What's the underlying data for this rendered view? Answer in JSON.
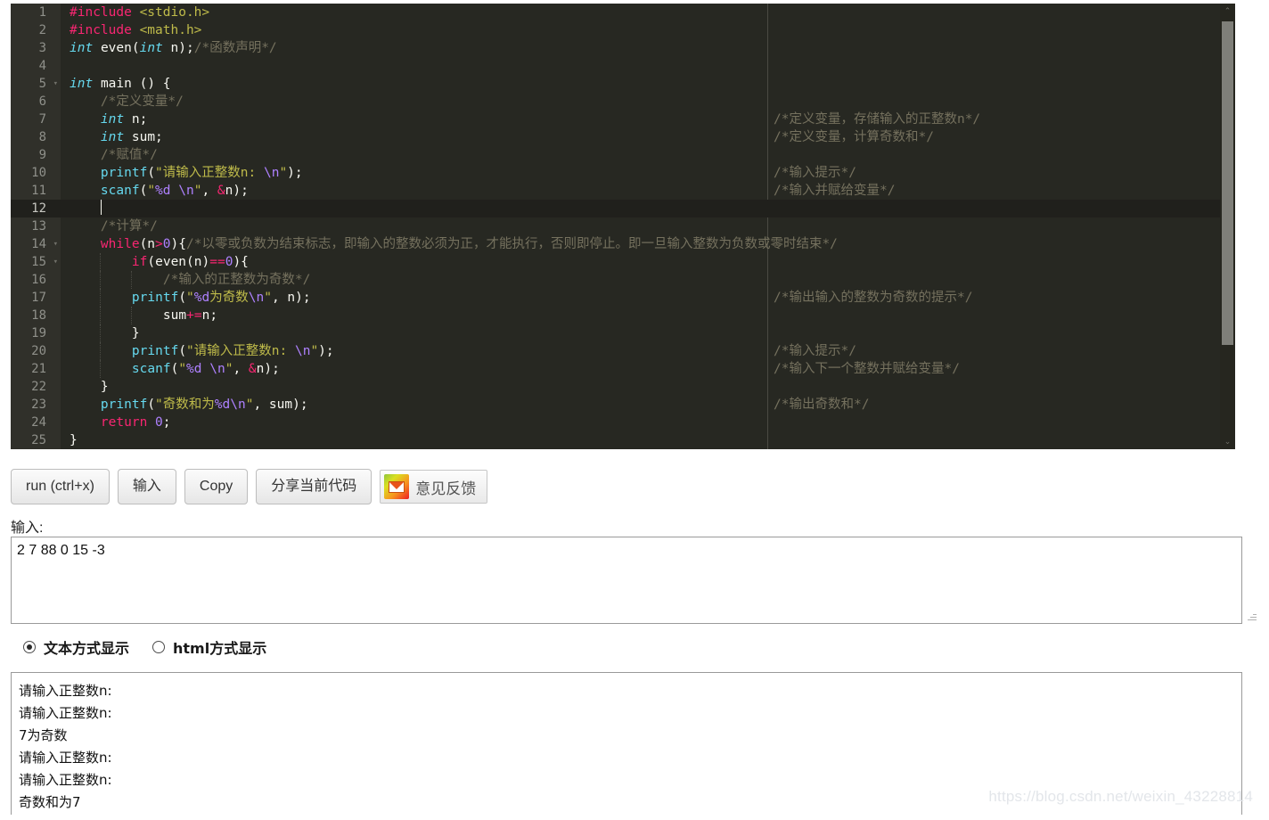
{
  "editor": {
    "active_line": 12,
    "theme_colors": {
      "background": "#272822",
      "gutter_background": "#30302a",
      "active_line": "#20201c",
      "comment": "#75715e",
      "keyword": "#66d9ef",
      "operator": "#f92672",
      "string": "#bfbb4a",
      "escape": "#ae81ff",
      "number": "#ae81ff",
      "foreground": "#f8f8f2"
    },
    "lines": [
      {
        "n": "1",
        "fold": false
      },
      {
        "n": "2",
        "fold": false
      },
      {
        "n": "3",
        "fold": false
      },
      {
        "n": "4",
        "fold": false
      },
      {
        "n": "5",
        "fold": true
      },
      {
        "n": "6",
        "fold": false
      },
      {
        "n": "7",
        "fold": false
      },
      {
        "n": "8",
        "fold": false
      },
      {
        "n": "9",
        "fold": false
      },
      {
        "n": "10",
        "fold": false
      },
      {
        "n": "11",
        "fold": false
      },
      {
        "n": "12",
        "fold": false
      },
      {
        "n": "13",
        "fold": false
      },
      {
        "n": "14",
        "fold": true
      },
      {
        "n": "15",
        "fold": true
      },
      {
        "n": "16",
        "fold": false
      },
      {
        "n": "17",
        "fold": false
      },
      {
        "n": "18",
        "fold": false
      },
      {
        "n": "19",
        "fold": false
      },
      {
        "n": "20",
        "fold": false
      },
      {
        "n": "21",
        "fold": false
      },
      {
        "n": "22",
        "fold": false
      },
      {
        "n": "23",
        "fold": false
      },
      {
        "n": "24",
        "fold": false
      },
      {
        "n": "25",
        "fold": false
      }
    ],
    "code_text": [
      "#include <stdio.h>",
      "#include <math.h>",
      "int even(int n);/*函数声明*/",
      "",
      "int main () {",
      "    /*定义变量*/",
      "    int n;",
      "    int sum;",
      "    /*赋值*/",
      "    printf(\"请输入正整数n: \\n\");",
      "    scanf(\"%d \\n\", &n);",
      "    ",
      "    /*计算*/",
      "    while(n>0){/*以零或负数为结束标志，即输入的整数必须为正，才能执行，否则即停止。即一旦输入整数为负数或零时结束*/",
      "        if(even(n)==0){",
      "            /*输入的正整数为奇数*/",
      "        printf(\"%d为奇数\\n\", n);",
      "            sum+=n;",
      "        }",
      "        printf(\"请输入正整数n: \\n\");",
      "        scanf(\"%d \\n\", &n);",
      "    }",
      "    printf(\"奇数和为%d\\n\", sum);",
      "    return 0;",
      "}"
    ],
    "side_comments": [
      {
        "line": 7,
        "text": "/*定义变量，存储输入的正整数n*/"
      },
      {
        "line": 8,
        "text": "/*定义变量，计算奇数和*/"
      },
      {
        "line": 10,
        "text": "/*输入提示*/"
      },
      {
        "line": 11,
        "text": "/*输入并赋给变量*/"
      },
      {
        "line": 17,
        "text": "/*输出输入的整数为奇数的提示*/"
      },
      {
        "line": 20,
        "text": "/*输入提示*/"
      },
      {
        "line": 21,
        "text": "/*输入下一个整数并赋给变量*/"
      },
      {
        "line": 23,
        "text": "/*输出奇数和*/"
      }
    ],
    "scrollbar": {
      "up_arrow": "⌃",
      "down_arrow": "⌄"
    }
  },
  "toolbar": {
    "run_label": "run (ctrl+x)",
    "input_label": "输入",
    "copy_label": "Copy",
    "share_label": "分享当前代码",
    "feedback_label": "意见反馈"
  },
  "input_section": {
    "label": "输入:",
    "value": "2 7 88 0 15 -3",
    "placeholder": ""
  },
  "display_mode": {
    "options": [
      {
        "label": "文本方式显示",
        "checked": true
      },
      {
        "label": "html方式显示",
        "checked": false
      }
    ]
  },
  "output": {
    "lines": [
      "请输入正整数n:",
      "请输入正整数n:",
      "7为奇数",
      "请输入正整数n:",
      "请输入正整数n:",
      "奇数和为7"
    ]
  },
  "watermark": {
    "text": "https://blog.csdn.net/weixin_43228814"
  }
}
